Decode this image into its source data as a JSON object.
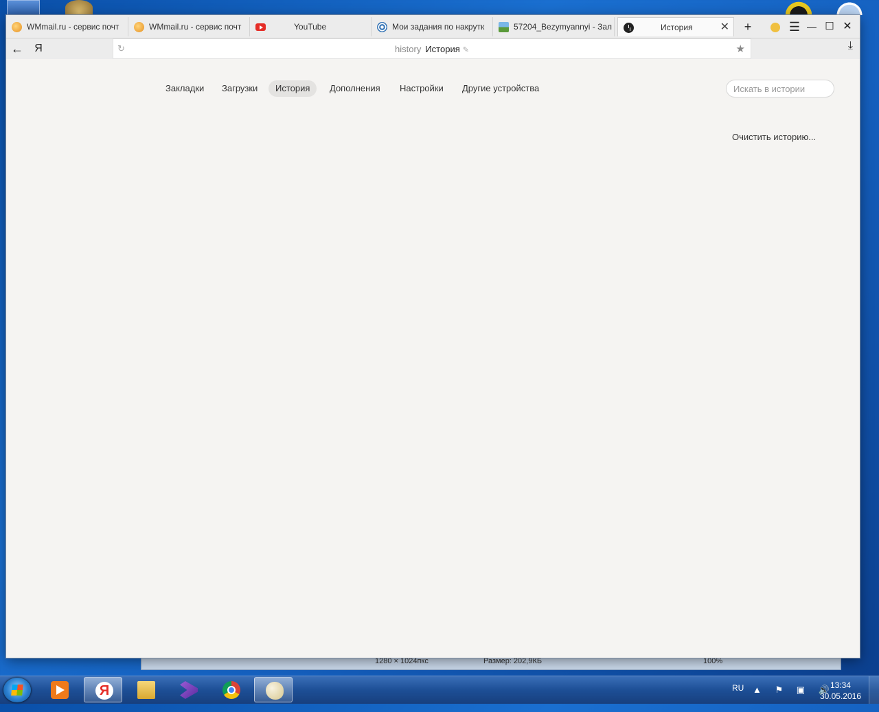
{
  "browser": {
    "tabs": [
      {
        "title": "WMmail.ru - сервис почт",
        "icon": "wmmail-icon"
      },
      {
        "title": "WMmail.ru - сервис почт",
        "icon": "wmmail-icon"
      },
      {
        "title": "YouTube",
        "icon": "youtube-icon"
      },
      {
        "title": "Мои задания по накрутк",
        "icon": "task-target-icon"
      },
      {
        "title": "57204_Bezymyannyi - Зал",
        "icon": "image-icon"
      },
      {
        "title": "История",
        "icon": "clock-icon",
        "active": true
      }
    ],
    "tab_close_glyph": "✕",
    "new_tab_glyph": "+",
    "menu_glyph": "☰",
    "minimize_glyph": "—",
    "maximize_glyph": "☐",
    "close_glyph": "✕",
    "back_glyph": "←",
    "yandex_glyph": "Я",
    "reload_glyph": "↻",
    "download_glyph": "⤓",
    "star_glyph": "★",
    "address": {
      "host": "history",
      "title": "История",
      "edit_glyph": "✎"
    }
  },
  "history_page": {
    "nav": [
      {
        "label": "Закладки"
      },
      {
        "label": "Загрузки"
      },
      {
        "label": "История",
        "selected": true
      },
      {
        "label": "Дополнения"
      },
      {
        "label": "Настройки"
      },
      {
        "label": "Другие устройства"
      }
    ],
    "search_placeholder": "Искать в истории",
    "clear_history": "Очистить историю..."
  },
  "viewer_strip": {
    "dimensions": "1280 × 1024пкс",
    "size": "Размер: 202,9КБ",
    "zoom": "100%"
  },
  "taskbar": {
    "language": "RU",
    "time": "13:34",
    "date": "30.05.2016",
    "tray_glyphs": "▲ ⚑ ▣ 🔊"
  },
  "colors": {
    "page_background": "#f5f4f2",
    "selected_nav": "#e4e3e1",
    "youtube_red": "#e52d27",
    "taskbar_blue": "#1d4f96"
  }
}
